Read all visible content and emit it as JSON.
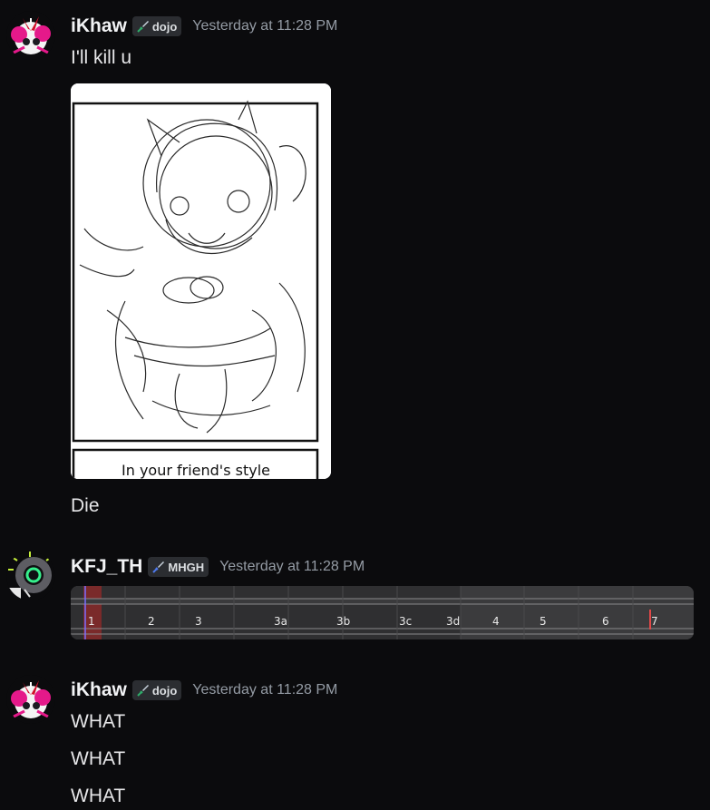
{
  "messages": [
    {
      "username": "iKhaw",
      "tag": "dojo",
      "timestamp": "Yesterday at 11:28 PM",
      "lines": [
        "I'll kill u",
        "Die"
      ],
      "attachment_caption": "In your friend's style"
    },
    {
      "username": "KFJ_TH",
      "tag": "MHGH",
      "timestamp": "Yesterday at 11:28 PM",
      "timeline_labels": [
        "1",
        "2",
        "3",
        "3a",
        "3b",
        "3c",
        "3d",
        "4",
        "5",
        "6",
        "7"
      ]
    },
    {
      "username": "iKhaw",
      "tag": "dojo",
      "timestamp": "Yesterday at 11:28 PM",
      "lines": [
        "WHAT",
        "WHAT",
        "WHAT"
      ]
    }
  ],
  "colors": {
    "background": "#0b0b0d",
    "username": "#f2f3f5",
    "timestamp": "#949ba4",
    "tag_bg": "#2b2d31"
  }
}
